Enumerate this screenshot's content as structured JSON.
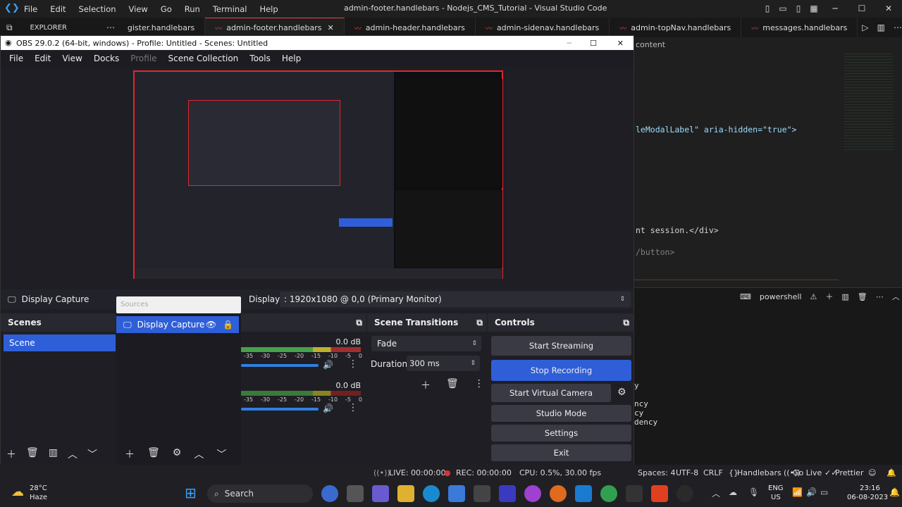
{
  "vscode": {
    "menu": [
      "File",
      "Edit",
      "Selection",
      "View",
      "Go",
      "Run",
      "Terminal",
      "Help"
    ],
    "window_title": "admin-footer.handlebars - Nodejs_CMS_Tutorial - Visual Studio Code",
    "explorer_label": "EXPLORER",
    "tabs": [
      {
        "label": "gister.handlebars"
      },
      {
        "label": "admin-footer.handlebars"
      },
      {
        "label": "admin-header.handlebars"
      },
      {
        "label": "admin-sidenav.handlebars"
      },
      {
        "label": "admin-topNav.handlebars"
      },
      {
        "label": "messages.handlebars"
      }
    ],
    "breadcrumb": "content",
    "code_lines": [
      "leModalLabel\" aria-hidden=\"true\">",
      "nt session.</div>",
      "/button>"
    ],
    "terminal_label": "powershell",
    "terminal_lines": [
      "y",
      "ncy",
      "cy",
      "dency"
    ],
    "status_right": [
      "Spaces: 4",
      "UTF-8",
      "CRLF",
      "Handlebars",
      "Go Live",
      "Prettier"
    ]
  },
  "obs": {
    "title": "OBS 29.0.2 (64-bit, windows) - Profile: Untitled - Scenes: Untitled",
    "menu": [
      "File",
      "Edit",
      "View",
      "Docks",
      "Profile",
      "Scene Collection",
      "Tools",
      "Help"
    ],
    "source_bar_label": "Display Capture",
    "display_label": "Display",
    "display_value": ": 1920x1080 @ 0,0 (Primary Monitor)",
    "sources_label": "Sources",
    "scenes_title": "Scenes",
    "scene_item": "Scene",
    "source_item": "Display Capture",
    "mixer": [
      {
        "db": "0.0 dB"
      },
      {
        "db": "0.0 dB"
      }
    ],
    "mixer_ticks": [
      "-35",
      "-30",
      "-25",
      "-20",
      "-15",
      "-10",
      "-5",
      "0"
    ],
    "transitions_title": "Scene Transitions",
    "transition_value": "Fade",
    "duration_label": "Duration",
    "duration_value": "300 ms",
    "controls_title": "Controls",
    "controls": {
      "start_streaming": "Start Streaming",
      "stop_recording": "Stop Recording",
      "start_virtual_camera": "Start Virtual Camera",
      "studio_mode": "Studio Mode",
      "settings": "Settings",
      "exit": "Exit"
    },
    "status": {
      "live": "LIVE: 00:00:00",
      "rec": "REC: 00:00:00",
      "cpu": "CPU: 0.5%, 30.00 fps"
    }
  },
  "taskbar": {
    "weather_temp": "28°C",
    "weather_desc": "Haze",
    "search_label": "Search",
    "lang": "ENG",
    "region": "US",
    "time": "23:16",
    "date": "06-08-2023"
  }
}
